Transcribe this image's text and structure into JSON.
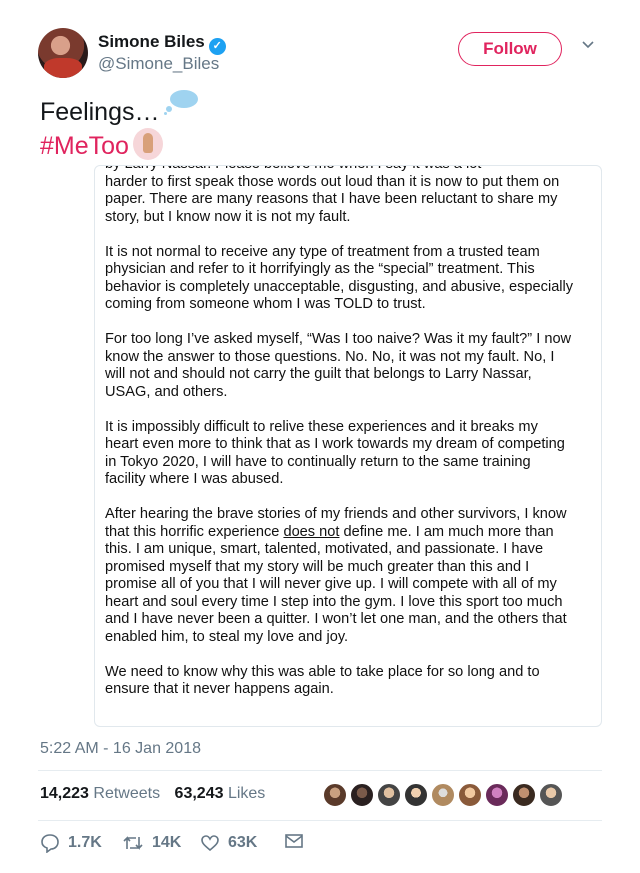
{
  "user": {
    "name": "Simone Biles",
    "handle": "@Simone_Biles",
    "follow_label": "Follow"
  },
  "tweet": {
    "line1": "Feelings…",
    "line2": "#MeToo"
  },
  "letter": {
    "partial_top": "by Larry Nassar. Please believe me when I say it was a lot",
    "p1": "harder to first speak those words out loud than it is now to put them on paper. There are many reasons that I have been reluctant to share my story, but I know now it is not my fault.",
    "p2": "It is not normal to receive any type of treatment from a trusted team physician and refer to it horrifyingly as the “special” treatment. This behavior is completely unacceptable, disgusting, and abusive, especially coming from someone whom I was TOLD to trust.",
    "p3": "For too long I’ve asked myself, “Was I too naive? Was it my fault?” I now know the answer to those questions.  No.  No, it was not my fault.  No, I will not and should not carry the guilt that belongs to Larry Nassar, USAG, and others.",
    "p4": "It is impossibly difficult to relive these experiences and it breaks my heart even more to think that as I work towards my dream of competing in Tokyo 2020, I will have to continually return to the same training facility where I was abused.",
    "p5_a": "After hearing the brave stories of my friends and other survivors, I know that this horrific experience ",
    "p5_u": "does not",
    "p5_b": " define me. I am much more than this. I am unique, smart, talented, motivated, and passionate. I have promised myself that my story will be much greater than this and I promise all of you that I will never give up.  I will compete with all of my heart and soul every time I step into the gym. I love this sport too much and I have never been a quitter. I won’t let one man, and the others that enabled him, to steal my love and joy.",
    "p6": "We need to know why this was able to take place for so long and to ensure that it never happens again."
  },
  "timestamp": "5:22 AM - 16 Jan 2018",
  "stats": {
    "retweets_count": "14,223",
    "retweets_label": "Retweets",
    "likes_count": "63,243",
    "likes_label": "Likes"
  },
  "actions": {
    "replies": "1.7K",
    "retweets": "14K",
    "likes": "63K"
  },
  "colors": {
    "accent": "#e0245e",
    "muted": "#657786",
    "verified": "#1da1f2"
  }
}
